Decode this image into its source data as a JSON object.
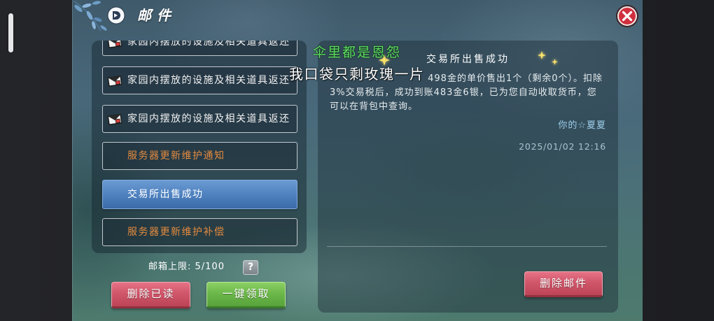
{
  "window": {
    "title": "邮件"
  },
  "mail_list": {
    "items": [
      {
        "label": "家园内摆放的设施及相关道具返还",
        "has_icon": true,
        "selected": false,
        "text_color": "#f1f1f1"
      },
      {
        "label": "家园内摆放的设施及相关道具返还",
        "has_icon": true,
        "selected": false,
        "text_color": "#f1f1f1"
      },
      {
        "label": "家园内摆放的设施及相关道具返还",
        "has_icon": true,
        "selected": false,
        "text_color": "#f1f1f1"
      },
      {
        "label": "服务器更新维护通知",
        "has_icon": false,
        "selected": false,
        "text_color": "#e38a3e"
      },
      {
        "label": "交易所出售成功",
        "has_icon": false,
        "selected": true,
        "text_color": "#ffffff"
      },
      {
        "label": "服务器更新维护补偿",
        "has_icon": false,
        "selected": false,
        "text_color": "#e38a3e"
      }
    ]
  },
  "mailbox": {
    "limit": "邮箱上限: 5/100",
    "help_label": "?"
  },
  "actions": {
    "delete_read": "删除已读",
    "claim_all": "一键领取"
  },
  "detail": {
    "title": "交易所出售成功",
    "body_lines": [
      "498金的单价售出1个（剩余0个）。扣除",
      "3%交易税后，成功到账483金6银，已为您自动收取货币，您",
      "可以在背包中查询。"
    ],
    "sender": "你的☆夏夏",
    "date": "2025/01/02 12:16",
    "delete_label": "删除邮件"
  },
  "overlay_lyrics": [
    "伞里都是恩怨",
    "我口袋只剩玫瑰一片"
  ],
  "icons": {
    "window": "mail-icon",
    "close": "close-icon",
    "list_item": "envelope-icon",
    "help": "help-icon",
    "decoration": "star-icon"
  },
  "colors": {
    "notice_text": "#e38a3e",
    "selected_item": "#4f82c0",
    "delete_button": "#d0566a",
    "claim_button": "#6cb84a",
    "close_button": "#d02f3d",
    "sender_text": "#9ccde9",
    "lyric_green": "#5fdd62",
    "star": "#f6e06a"
  }
}
